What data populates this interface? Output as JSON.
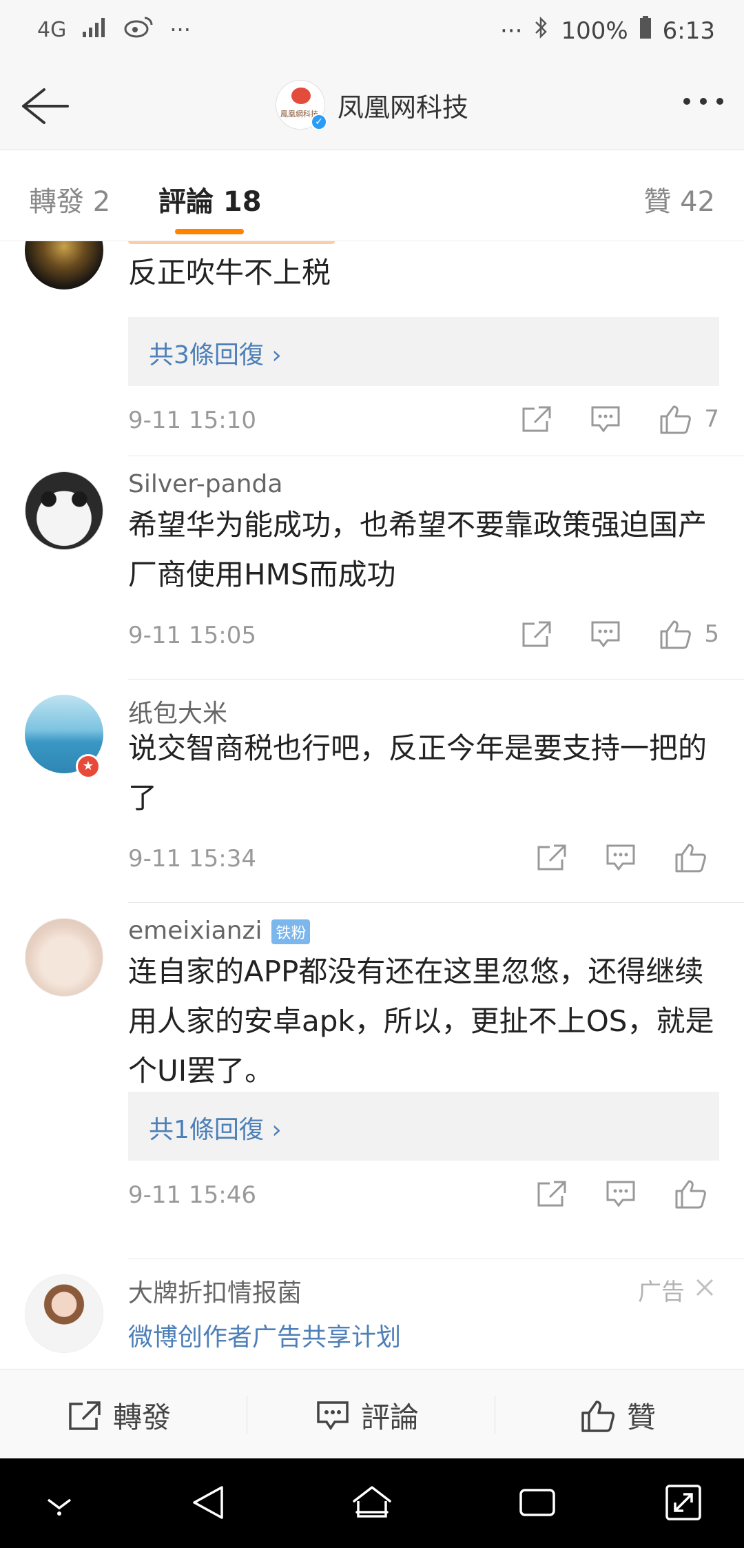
{
  "status_bar": {
    "network": "4G",
    "extra": "···",
    "right_extra": "···",
    "battery": "100%",
    "time": "6:13"
  },
  "header": {
    "title": "凤凰网科技",
    "avatar_text": "鳳凰網科技"
  },
  "tabs": [
    {
      "label": "轉發 2"
    },
    {
      "label": "評論 18"
    },
    {
      "label": "贊 42"
    }
  ],
  "comments": [
    {
      "text": "反正吹牛不上税",
      "replies": "共3條回復 ›",
      "time": "9-11 15:10",
      "likes": "7"
    },
    {
      "username": "Silver-panda",
      "text": "希望华为能成功，也希望不要靠政策强迫国产厂商使用HMS而成功",
      "time": "9-11 15:05",
      "likes": "5"
    },
    {
      "username": "纸包大米",
      "text": "说交智商税也行吧，反正今年是要支持一把的了",
      "time": "9-11 15:34",
      "likes": ""
    },
    {
      "username": "emeixianzi",
      "badge": "铁粉",
      "text": "连自家的APP都没有还在这里忽悠，还得继续用人家的安卓apk，所以，更扯不上OS，就是个UI罢了。",
      "replies": "共1條回復 ›",
      "time": "9-11 15:46",
      "likes": ""
    }
  ],
  "ad": {
    "username": "大牌折扣情报菌",
    "tag": "广告",
    "link": "微博创作者广告共享计划"
  },
  "bottom_bar": {
    "repost": "轉發",
    "comment": "評論",
    "like": "贊"
  },
  "colors": {
    "accent": "#ff8200",
    "link": "#4d7fb8",
    "verified": "#2b9cf5"
  }
}
